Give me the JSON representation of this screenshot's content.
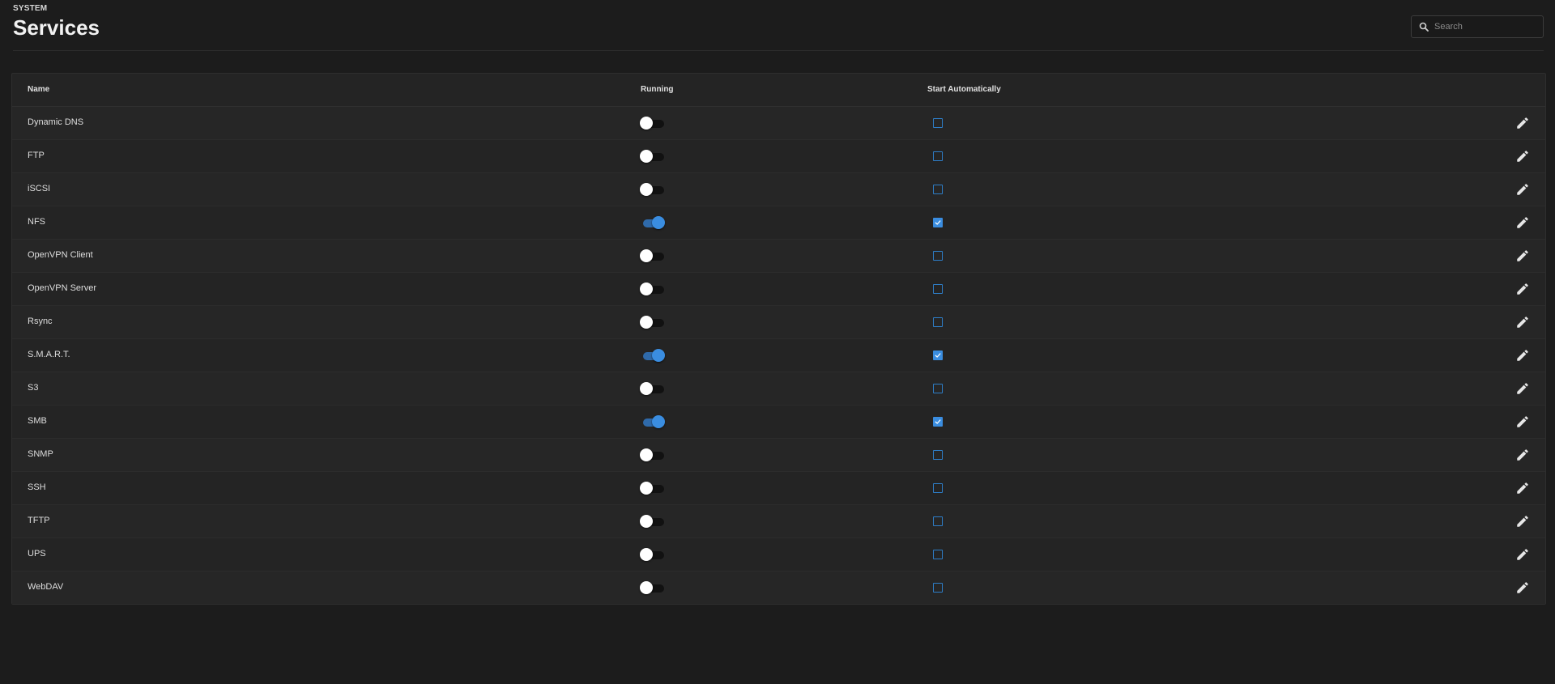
{
  "header": {
    "breadcrumb": "SYSTEM",
    "title": "Services"
  },
  "search": {
    "placeholder": "Search",
    "value": ""
  },
  "table": {
    "columns": {
      "name": "Name",
      "running": "Running",
      "start_automatically": "Start Automatically"
    },
    "rows": [
      {
        "name": "Dynamic DNS",
        "running": false,
        "start_automatically": false
      },
      {
        "name": "FTP",
        "running": false,
        "start_automatically": false
      },
      {
        "name": "iSCSI",
        "running": false,
        "start_automatically": false
      },
      {
        "name": "NFS",
        "running": true,
        "start_automatically": true
      },
      {
        "name": "OpenVPN Client",
        "running": false,
        "start_automatically": false
      },
      {
        "name": "OpenVPN Server",
        "running": false,
        "start_automatically": false
      },
      {
        "name": "Rsync",
        "running": false,
        "start_automatically": false
      },
      {
        "name": "S.M.A.R.T.",
        "running": true,
        "start_automatically": true
      },
      {
        "name": "S3",
        "running": false,
        "start_automatically": false
      },
      {
        "name": "SMB",
        "running": true,
        "start_automatically": true
      },
      {
        "name": "SNMP",
        "running": false,
        "start_automatically": false
      },
      {
        "name": "SSH",
        "running": false,
        "start_automatically": false
      },
      {
        "name": "TFTP",
        "running": false,
        "start_automatically": false
      },
      {
        "name": "UPS",
        "running": false,
        "start_automatically": false
      },
      {
        "name": "WebDAV",
        "running": false,
        "start_automatically": false
      }
    ]
  },
  "colors": {
    "background": "#1c1c1c",
    "card": "#242424",
    "accent": "#3a8de0"
  },
  "icons": {
    "search": "search-icon",
    "edit": "pencil-icon",
    "check": "check-icon"
  }
}
